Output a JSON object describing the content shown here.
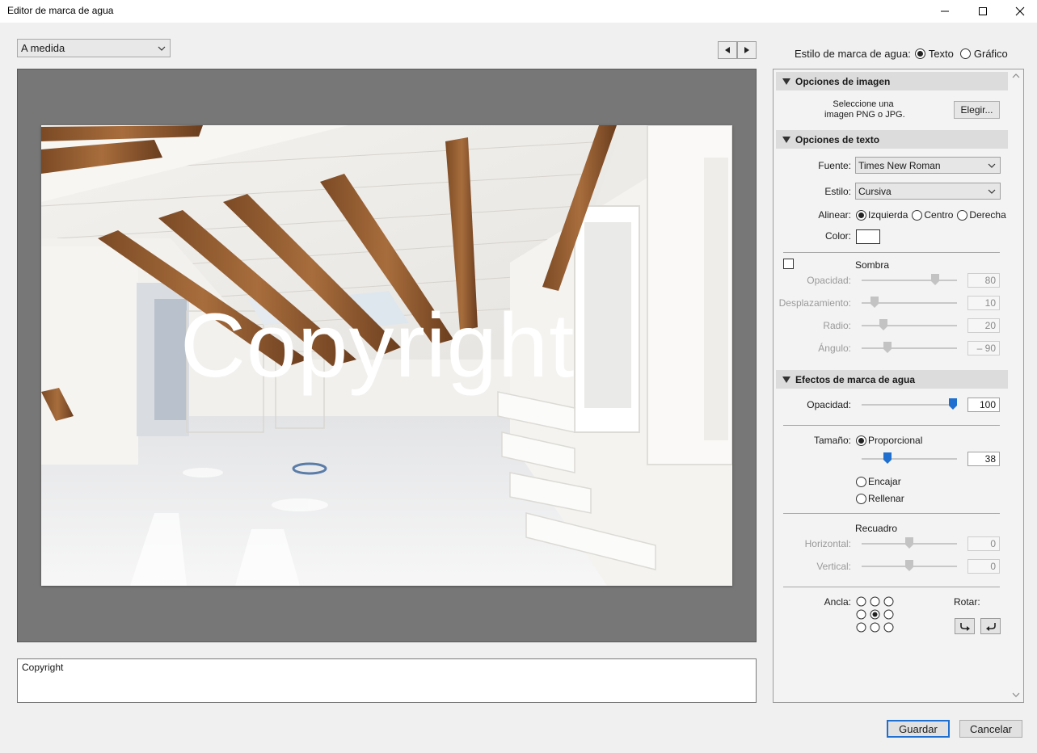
{
  "window": {
    "title": "Editor de marca de agua"
  },
  "preset": {
    "selected": "A medida"
  },
  "preview": {
    "watermark_text": "Copyright"
  },
  "text_input": {
    "value": "Copyright"
  },
  "watermark_style": {
    "label": "Estilo de marca de agua:",
    "options": [
      "Texto",
      "Gráfico"
    ],
    "selected": "Texto"
  },
  "image_options": {
    "header": "Opciones de imagen",
    "hint_line1": "Seleccione una",
    "hint_line2": "imagen PNG o JPG.",
    "choose_label": "Elegir..."
  },
  "text_options": {
    "header": "Opciones de texto",
    "font_label": "Fuente:",
    "font_value": "Times New Roman",
    "style_label": "Estilo:",
    "style_value": "Cursiva",
    "align_label": "Alinear:",
    "align_options": [
      "Izquierda",
      "Centro",
      "Derecha"
    ],
    "align_selected": "Izquierda",
    "color_label": "Color:",
    "color_value": "#ffffff",
    "shadow": {
      "label": "Sombra",
      "enabled": false,
      "opacity_label": "Opacidad:",
      "opacity": "80",
      "offset_label": "Desplazamiento:",
      "offset": "10",
      "radius_label": "Radio:",
      "radius": "20",
      "angle_label": "Ángulo:",
      "angle": "– 90"
    }
  },
  "effects": {
    "header": "Efectos de marca de agua",
    "opacity_label": "Opacidad:",
    "opacity": "100",
    "size_label": "Tamaño:",
    "size_options": [
      "Proporcional",
      "Encajar",
      "Rellenar"
    ],
    "size_selected": "Proporcional",
    "size_value": "38",
    "inset_label": "Recuadro",
    "horizontal_label": "Horizontal:",
    "horizontal": "0",
    "vertical_label": "Vertical:",
    "vertical": "0",
    "anchor_label": "Ancla:",
    "anchor_selected": "center",
    "rotate_label": "Rotar:"
  },
  "footer": {
    "save_label": "Guardar",
    "cancel_label": "Cancelar"
  },
  "colors": {
    "accent": "#1f6fd0",
    "preview_bg": "#777777"
  }
}
